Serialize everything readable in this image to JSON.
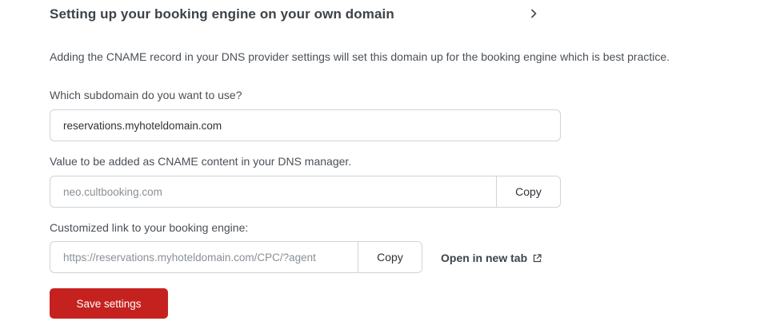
{
  "section": {
    "title": "Setting up your booking engine on your own domain",
    "chevron_icon": "chevron-right-icon"
  },
  "description": "Adding the CNAME record in your DNS provider settings will set this domain up for the booking engine which is best practice.",
  "subdomain": {
    "label": "Which subdomain do you want to use?",
    "value": "reservations.myhoteldomain.com"
  },
  "cname": {
    "label": "Value to be added as CNAME content in your DNS manager.",
    "value": "neo.cultbooking.com",
    "copy_label": "Copy"
  },
  "custom_link": {
    "label": "Customized link to your booking engine:",
    "value": "https://reservations.myhoteldomain.com/CPC/?agent",
    "copy_label": "Copy",
    "open_label": "Open in new tab",
    "open_icon": "external-link-icon"
  },
  "save_label": "Save settings",
  "colors": {
    "save_button": "#c5221f",
    "text": "#4a5057",
    "border": "#cfd3d7"
  }
}
